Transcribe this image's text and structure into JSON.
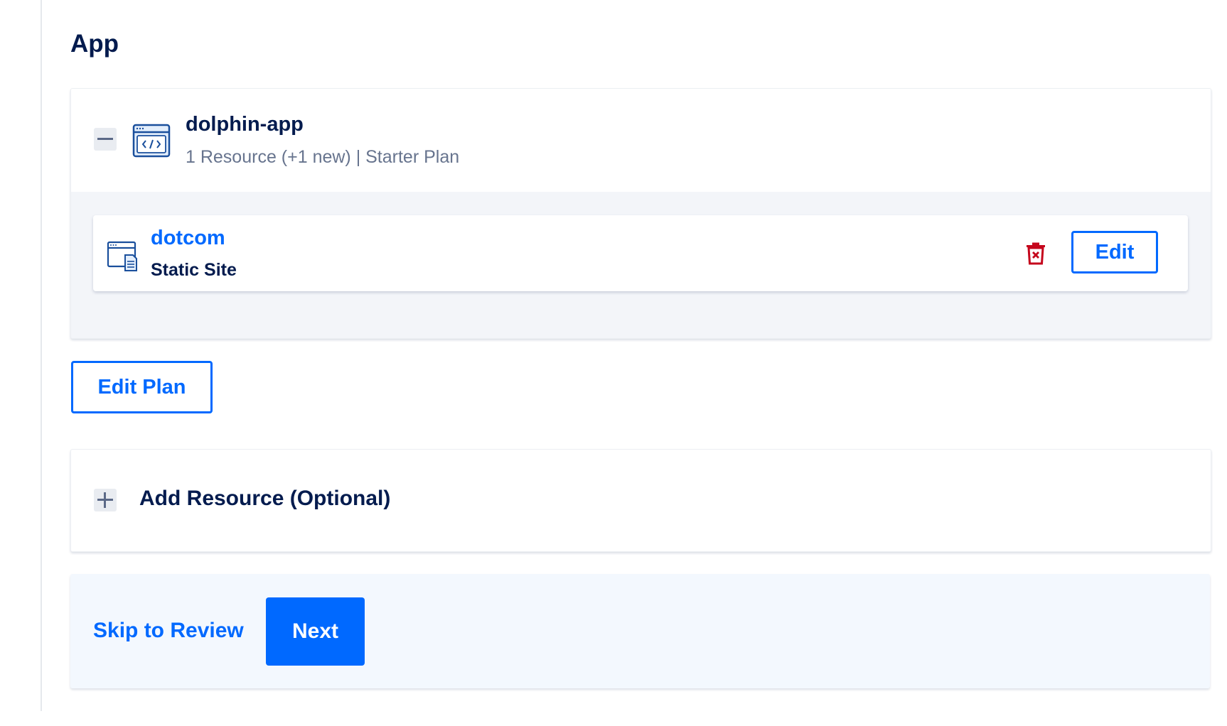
{
  "section": {
    "title": "App"
  },
  "app": {
    "name": "dolphin-app",
    "meta": "1 Resource (+1 new) | Starter Plan",
    "icon": "code-window-icon",
    "toggle_icon": "minus-icon",
    "expanded": true
  },
  "component": {
    "name": "dotcom",
    "type": "Static Site",
    "icon": "static-site-icon",
    "delete_icon": "trash-icon",
    "edit_label": "Edit"
  },
  "edit_plan": {
    "label": "Edit Plan"
  },
  "add_resource": {
    "label": "Add Resource (Optional)",
    "toggle_icon": "plus-icon"
  },
  "footer": {
    "skip_label": "Skip to Review",
    "next_label": "Next"
  },
  "colors": {
    "primary": "#0069ff",
    "text": "#031b4e",
    "muted": "#67748e",
    "danger": "#c5061c",
    "panel": "#f3f5f9",
    "footer_bg": "#f3f8fe"
  }
}
